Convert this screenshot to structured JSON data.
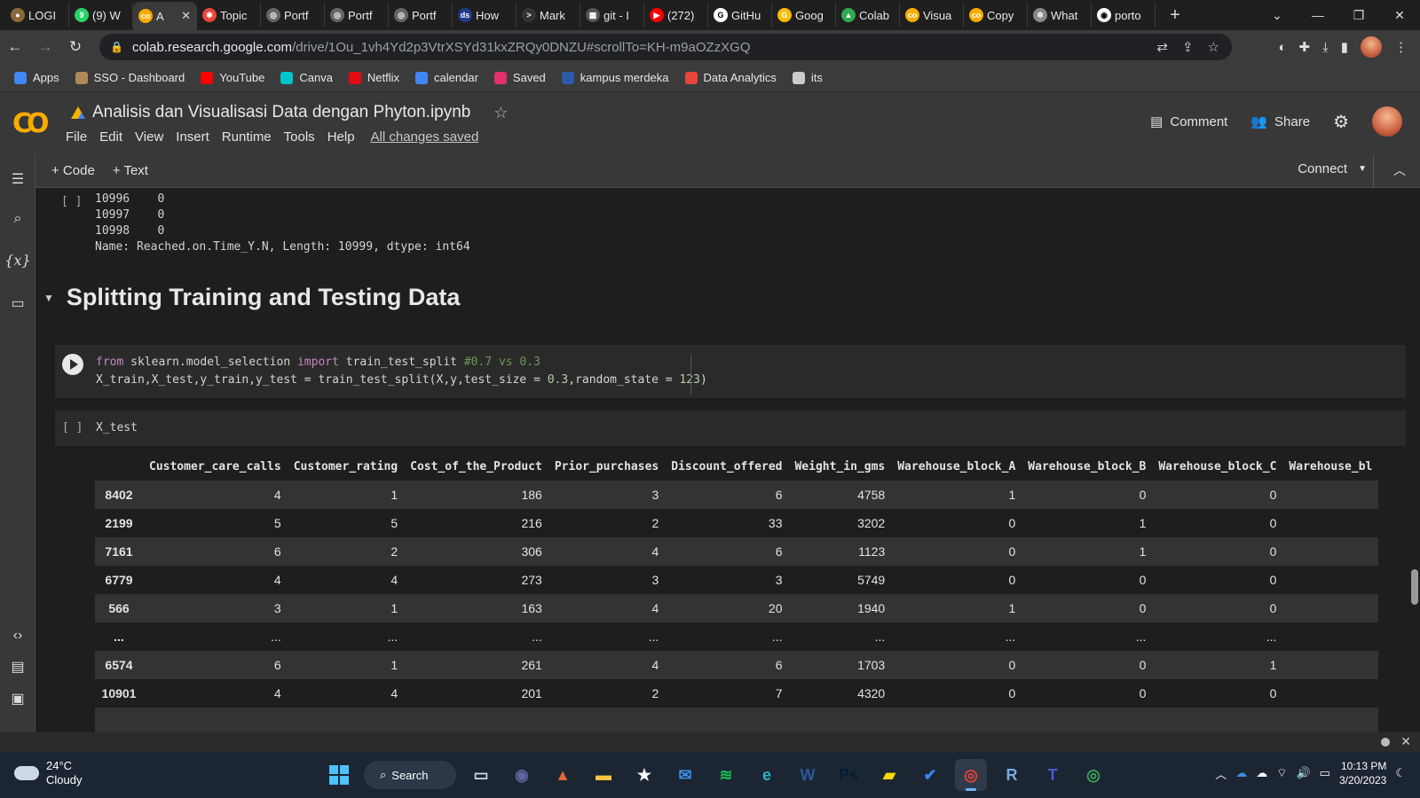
{
  "browser": {
    "tabs": [
      {
        "title": "LOGI",
        "color": "#8a6a3a",
        "glyph": "●",
        "active": false
      },
      {
        "title": "(9) W",
        "color": "#25d366",
        "glyph": "9",
        "active": false
      },
      {
        "title": "A",
        "color": "#f9ab00",
        "glyph": "co",
        "active": true
      },
      {
        "title": "Topic",
        "color": "#e8453c",
        "glyph": "✱",
        "active": false
      },
      {
        "title": "Portf",
        "color": "#666666",
        "glyph": "◎",
        "active": false
      },
      {
        "title": "Portf",
        "color": "#666666",
        "glyph": "◎",
        "active": false
      },
      {
        "title": "Portf",
        "color": "#666666",
        "glyph": "◎",
        "active": false
      },
      {
        "title": "How",
        "color": "#1e3a8a",
        "glyph": "ds",
        "active": false
      },
      {
        "title": "Mark",
        "color": "#333333",
        "glyph": ">",
        "active": false
      },
      {
        "title": "git - I",
        "color": "#555555",
        "glyph": "▦",
        "active": false
      },
      {
        "title": "(272)",
        "color": "#ff0000",
        "glyph": "▶",
        "active": false
      },
      {
        "title": "GitHu",
        "color": "#ffffff",
        "glyph": "G",
        "active": false
      },
      {
        "title": "Goog",
        "color": "#fbbc04",
        "glyph": "G",
        "active": false
      },
      {
        "title": "Colab",
        "color": "#34a853",
        "glyph": "▲",
        "active": false
      },
      {
        "title": "Visua",
        "color": "#f9ab00",
        "glyph": "co",
        "active": false
      },
      {
        "title": "Copy",
        "color": "#f9ab00",
        "glyph": "co",
        "active": false
      },
      {
        "title": "What",
        "color": "#888888",
        "glyph": "✲",
        "active": false
      },
      {
        "title": "porto",
        "color": "#ffffff",
        "glyph": "◉",
        "active": false
      }
    ],
    "url_host": "colab.research.google.com",
    "url_path": "/drive/1Ou_1vh4Yd2p3VtrXSYd31kxZRQy0DNZU#scrollTo=KH-m9aOZzXGQ",
    "bookmarks": [
      {
        "label": "Apps",
        "color": "#4285f4"
      },
      {
        "label": "SSO - Dashboard",
        "color": "#b08a5a"
      },
      {
        "label": "YouTube",
        "color": "#ff0000"
      },
      {
        "label": "Canva",
        "color": "#00c4cc"
      },
      {
        "label": "Netflix",
        "color": "#e50914"
      },
      {
        "label": "calendar",
        "color": "#4285f4"
      },
      {
        "label": "Saved",
        "color": "#e1306c"
      },
      {
        "label": "kampus merdeka",
        "color": "#2b5cab"
      },
      {
        "label": "Data Analytics",
        "color": "#e8453c"
      },
      {
        "label": "its",
        "color": "#cccccc"
      }
    ]
  },
  "colab": {
    "notebook_title": "Analisis dan Visualisasi Data dengan Phyton.ipynb",
    "menus": [
      "File",
      "Edit",
      "View",
      "Insert",
      "Runtime",
      "Tools",
      "Help"
    ],
    "save_status": "All changes saved",
    "comment_label": "Comment",
    "share_label": "Share",
    "add_code_label": "+ Code",
    "add_text_label": "+ Text",
    "connect_label": "Connect"
  },
  "notebook": {
    "prev_output": "10996    0\n10997    0\n10998    0\nName: Reached.on.Time_Y.N, Length: 10999, dtype: int64",
    "section_title": "Splitting Training and Testing Data",
    "empty_bracket": "[ ]",
    "code_cell_2": "X_test",
    "dataframe": {
      "columns": [
        "",
        "Customer_care_calls",
        "Customer_rating",
        "Cost_of_the_Product",
        "Prior_purchases",
        "Discount_offered",
        "Weight_in_gms",
        "Warehouse_block_A",
        "Warehouse_block_B",
        "Warehouse_block_C",
        "Warehouse_bl"
      ],
      "rows": [
        [
          "8402",
          "4",
          "1",
          "186",
          "3",
          "6",
          "4758",
          "1",
          "0",
          "0",
          ""
        ],
        [
          "2199",
          "5",
          "5",
          "216",
          "2",
          "33",
          "3202",
          "0",
          "1",
          "0",
          ""
        ],
        [
          "7161",
          "6",
          "2",
          "306",
          "4",
          "6",
          "1123",
          "0",
          "1",
          "0",
          ""
        ],
        [
          "6779",
          "4",
          "4",
          "273",
          "3",
          "3",
          "5749",
          "0",
          "0",
          "0",
          ""
        ],
        [
          "566",
          "3",
          "1",
          "163",
          "4",
          "20",
          "1940",
          "1",
          "0",
          "0",
          ""
        ],
        [
          "...",
          "...",
          "...",
          "...",
          "...",
          "...",
          "...",
          "...",
          "...",
          "...",
          ""
        ],
        [
          "6574",
          "6",
          "1",
          "261",
          "4",
          "6",
          "1703",
          "0",
          "0",
          "1",
          ""
        ],
        [
          "10901",
          "4",
          "4",
          "201",
          "2",
          "7",
          "4320",
          "0",
          "0",
          "0",
          ""
        ],
        [
          "",
          "",
          "",
          "",
          "",
          "",
          "",
          "",
          "",
          "",
          ""
        ]
      ]
    }
  },
  "taskbar": {
    "temp": "24°C",
    "condition": "Cloudy",
    "search_label": "Search",
    "time": "10:13 PM",
    "date": "3/20/2023",
    "apps": [
      {
        "name": "task-view",
        "color": "#cfd8e6",
        "glyph": "▭"
      },
      {
        "name": "teams-chat",
        "color": "#6264a7",
        "glyph": "◉"
      },
      {
        "name": "matlab",
        "color": "#e16737",
        "glyph": "▲"
      },
      {
        "name": "file-explorer",
        "color": "#f8c444",
        "glyph": "▬"
      },
      {
        "name": "store",
        "color": "#ffffff",
        "glyph": "★"
      },
      {
        "name": "mail",
        "color": "#3b8ee8",
        "glyph": "✉"
      },
      {
        "name": "spotify",
        "color": "#1db954",
        "glyph": "≋"
      },
      {
        "name": "edge",
        "color": "#2fb3c3",
        "glyph": "e"
      },
      {
        "name": "word",
        "color": "#2b579a",
        "glyph": "W"
      },
      {
        "name": "photoshop",
        "color": "#001e36",
        "glyph": "Ps"
      },
      {
        "name": "sticky-notes",
        "color": "#f5d90a",
        "glyph": "▰"
      },
      {
        "name": "todo",
        "color": "#3b82f6",
        "glyph": "✔"
      },
      {
        "name": "chrome",
        "color": "#ea4335",
        "glyph": "◎"
      },
      {
        "name": "rstudio",
        "color": "#75aadb",
        "glyph": "R"
      },
      {
        "name": "teams",
        "color": "#5059c9",
        "glyph": "T"
      },
      {
        "name": "chrome-2",
        "color": "#34a853",
        "glyph": "◎"
      }
    ]
  }
}
